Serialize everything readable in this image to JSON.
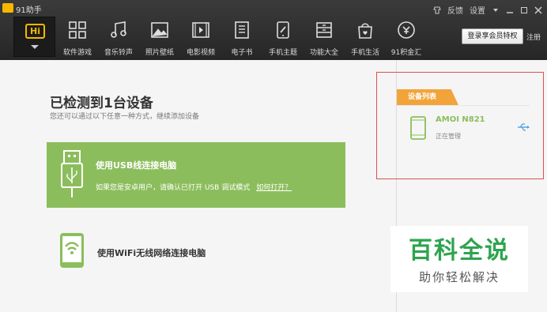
{
  "app": {
    "name": "91助手"
  },
  "titlebar": {
    "feedback": "反馈",
    "settings": "设置"
  },
  "hi": {
    "label": "Hi"
  },
  "nav": [
    {
      "label": "软件游戏",
      "icon": "apps-grid-icon"
    },
    {
      "label": "音乐铃声",
      "icon": "music-note-icon"
    },
    {
      "label": "照片壁纸",
      "icon": "photo-icon"
    },
    {
      "label": "电影视频",
      "icon": "video-icon"
    },
    {
      "label": "电子书",
      "icon": "ebook-icon"
    },
    {
      "label": "手机主题",
      "icon": "theme-icon"
    },
    {
      "label": "功能大全",
      "icon": "toolbox-icon"
    },
    {
      "label": "手机生活",
      "icon": "shopping-bag-icon"
    },
    {
      "label": "91积金汇",
      "icon": "gold-exchange-icon"
    }
  ],
  "account": {
    "vip_login": "登录享会员特权",
    "register": "注册"
  },
  "main": {
    "title": "已检测到1台设备",
    "subtitle": "您还可以通过以下任意一种方式，继续添加设备",
    "usb": {
      "title": "使用USB线连接电脑",
      "desc": "如果您是安卓用户，请确认已打开 USB 调试模式",
      "link": "如何打开？"
    },
    "wifi": {
      "title": "使用WiFi无线网络连接电脑"
    }
  },
  "device_panel": {
    "tab": "设备列表",
    "device_name": "AMOI N821",
    "status": "正在管理"
  },
  "watermark": {
    "main": "百科全说",
    "sub": "助你轻松解决"
  },
  "colors": {
    "accent_green": "#8cbd5c",
    "tab_orange": "#f2a43a",
    "logo_yellow": "#f5b700",
    "highlight_red": "#d9534f"
  }
}
